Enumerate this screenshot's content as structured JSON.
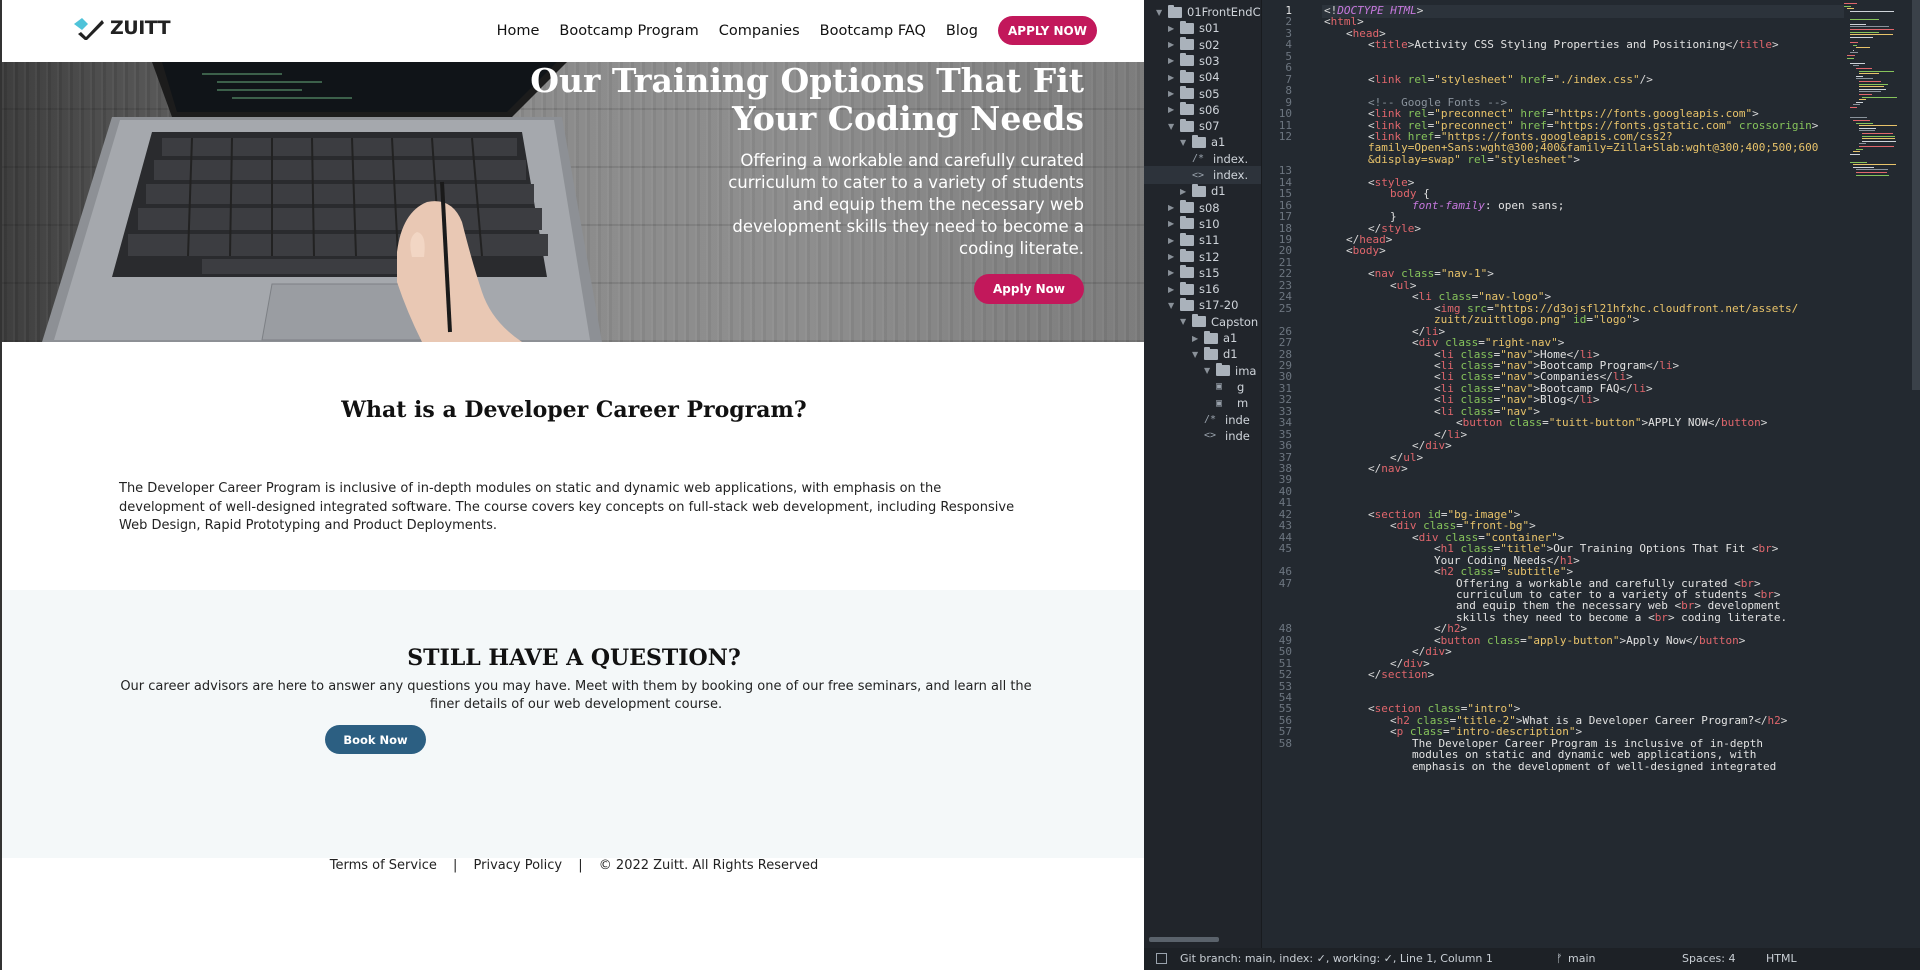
{
  "site": {
    "logo_text": "ZUITT",
    "nav": [
      "Home",
      "Bootcamp Program",
      "Companies",
      "Bootcamp FAQ",
      "Blog"
    ],
    "apply_now": "APPLY NOW",
    "hero": {
      "title_line1": "Our Training Options That Fit",
      "title_line2": "Your Coding Needs",
      "subtitle_lines": [
        "Offering a workable and carefully curated",
        "curriculum to cater to a variety of students",
        "and equip them the necessary web",
        "development skills they need to become a",
        "coding literate."
      ],
      "button": "Apply Now"
    },
    "intro": {
      "title": "What is a Developer Career Program?",
      "description": "The Developer Career Program is inclusive of in-depth modules on static and dynamic web applications, with emphasis on the development of well-designed integrated software. The course covers key concepts on full-stack web development, including Responsive Web Design, Rapid Prototyping and Product Deployments."
    },
    "question": {
      "title": "STILL HAVE A QUESTION?",
      "description": "Our career advisors are here to answer any questions you may have. Meet with them by booking one of our free seminars, and learn all the finer details of our web development course.",
      "button": "Book Now"
    },
    "footer": {
      "terms": "Terms of Service",
      "sep": "|",
      "privacy": "Privacy Policy",
      "copyright": "© 2022 Zuitt. All Rights Reserved"
    }
  },
  "editor": {
    "tree": [
      {
        "label": "01FrontEndC",
        "depth": 0,
        "open": true
      },
      {
        "label": "s01",
        "depth": 1,
        "open": false
      },
      {
        "label": "s02",
        "depth": 1,
        "open": false
      },
      {
        "label": "s03",
        "depth": 1,
        "open": false
      },
      {
        "label": "s04",
        "depth": 1,
        "open": false
      },
      {
        "label": "s05",
        "depth": 1,
        "open": false
      },
      {
        "label": "s06",
        "depth": 1,
        "open": false
      },
      {
        "label": "s07",
        "depth": 1,
        "open": true
      },
      {
        "label": "a1",
        "depth": 2,
        "open": true
      },
      {
        "label": "index.",
        "depth": 3,
        "file": "/*"
      },
      {
        "label": "index.",
        "depth": 3,
        "file": "<>",
        "active": true
      },
      {
        "label": "d1",
        "depth": 2,
        "open": false
      },
      {
        "label": "s08",
        "depth": 1,
        "open": false
      },
      {
        "label": "s10",
        "depth": 1,
        "open": false
      },
      {
        "label": "s11",
        "depth": 1,
        "open": false
      },
      {
        "label": "s12",
        "depth": 1,
        "open": false
      },
      {
        "label": "s15",
        "depth": 1,
        "open": false
      },
      {
        "label": "s16",
        "depth": 1,
        "open": false
      },
      {
        "label": "s17-20",
        "depth": 1,
        "open": true
      },
      {
        "label": "Capston",
        "depth": 2,
        "open": true
      },
      {
        "label": "a1",
        "depth": 3,
        "open": false
      },
      {
        "label": "d1",
        "depth": 3,
        "open": true
      },
      {
        "label": "ima",
        "depth": 4,
        "open": true
      },
      {
        "label": "g",
        "depth": 5,
        "file": "img"
      },
      {
        "label": "m",
        "depth": 5,
        "file": "img"
      },
      {
        "label": "inde",
        "depth": 4,
        "file": "/*"
      },
      {
        "label": "inde",
        "depth": 4,
        "file": "<>"
      }
    ],
    "status": {
      "left": "Git branch: main, index: ✓, working: ✓, Line 1, Column 1",
      "branch": "main",
      "spaces": "Spaces: 4",
      "syntax": "HTML"
    },
    "lines": [
      {
        "n": "1",
        "i": 0,
        "h": "<span class='p'>&lt;!</span><span class='k'>DOCTYPE HTML</span><span class='p'>&gt;</span>"
      },
      {
        "n": "2",
        "i": 0,
        "h": "<span class='p'>&lt;</span><span class='t'>html</span><span class='p'>&gt;</span>"
      },
      {
        "n": "3",
        "i": 1,
        "h": "<span class='p'>&lt;</span><span class='t'>head</span><span class='p'>&gt;</span>"
      },
      {
        "n": "4",
        "i": 2,
        "h": "<span class='p'>&lt;</span><span class='t'>title</span><span class='p'>&gt;</span>Activity CSS Styling Properties and Positioning<span class='p'>&lt;/</span><span class='t'>title</span><span class='p'>&gt;</span>"
      },
      {
        "n": "5",
        "i": 0,
        "h": ""
      },
      {
        "n": "6",
        "i": 0,
        "h": ""
      },
      {
        "n": "7",
        "i": 2,
        "h": "<span class='p'>&lt;</span><span class='t'>link</span> <span class='a'>rel</span>=<span class='s'>\"stylesheet\"</span> <span class='a'>href</span>=<span class='s'>\"./index.css\"</span><span class='p'>/&gt;</span>"
      },
      {
        "n": "8",
        "i": 0,
        "h": ""
      },
      {
        "n": "9",
        "i": 2,
        "h": "<span class='c'>&lt;!-- Google Fonts --&gt;</span>"
      },
      {
        "n": "10",
        "i": 2,
        "h": "<span class='p'>&lt;</span><span class='t'>link</span> <span class='a'>rel</span>=<span class='s'>\"preconnect\"</span> <span class='a'>href</span>=<span class='s'>\"https://fonts.googleapis.com\"</span><span class='p'>&gt;</span>"
      },
      {
        "n": "11",
        "i": 2,
        "h": "<span class='p'>&lt;</span><span class='t'>link</span> <span class='a'>rel</span>=<span class='s'>\"preconnect\"</span> <span class='a'>href</span>=<span class='s'>\"https://fonts.gstatic.com\"</span> <span class='a'>crossorigin</span><span class='p'>&gt;</span>"
      },
      {
        "n": "12",
        "i": 2,
        "h": "<span class='p'>&lt;</span><span class='t'>link</span> <span class='a'>href</span>=<span class='s'>\"https://fonts.googleapis.com/css2?</span>"
      },
      {
        "n": "",
        "i": 2,
        "h": "<span class='s'>family=Open+Sans:wght@300;400&amp;family=Zilla+Slab:wght@300;400;500;600</span>"
      },
      {
        "n": "",
        "i": 2,
        "h": "<span class='s'>&amp;display=swap\"</span> <span class='a'>rel</span>=<span class='s'>\"stylesheet\"</span><span class='p'>&gt;</span>"
      },
      {
        "n": "13",
        "i": 0,
        "h": ""
      },
      {
        "n": "14",
        "i": 2,
        "h": "<span class='p'>&lt;</span><span class='t'>style</span><span class='p'>&gt;</span>"
      },
      {
        "n": "15",
        "i": 3,
        "h": "<span class='t'>body</span> {"
      },
      {
        "n": "16",
        "i": 4,
        "h": "<span class='k'>font-family</span>: open sans;"
      },
      {
        "n": "17",
        "i": 3,
        "h": "}"
      },
      {
        "n": "18",
        "i": 2,
        "h": "<span class='p'>&lt;/</span><span class='t'>style</span><span class='p'>&gt;</span>"
      },
      {
        "n": "19",
        "i": 1,
        "h": "<span class='p'>&lt;/</span><span class='t'>head</span><span class='p'>&gt;</span>"
      },
      {
        "n": "20",
        "i": 1,
        "h": "<span class='p'>&lt;</span><span class='t'>body</span><span class='p'>&gt;</span>"
      },
      {
        "n": "21",
        "i": 0,
        "h": ""
      },
      {
        "n": "22",
        "i": 2,
        "h": "<span class='p'>&lt;</span><span class='t'>nav</span> <span class='a'>class</span>=<span class='s'>\"nav-1\"</span><span class='p'>&gt;</span>"
      },
      {
        "n": "23",
        "i": 3,
        "h": "<span class='p'>&lt;</span><span class='t'>ul</span><span class='p'>&gt;</span>"
      },
      {
        "n": "24",
        "i": 4,
        "h": "<span class='p'>&lt;</span><span class='t'>li</span> <span class='a'>class</span>=<span class='s'>\"nav-logo\"</span><span class='p'>&gt;</span>"
      },
      {
        "n": "25",
        "i": 5,
        "h": "<span class='p'>&lt;</span><span class='t'>img</span> <span class='a'>src</span>=<span class='s'>\"https://d3ojsfl21hfxhc.cloudfront.net/assets/</span>"
      },
      {
        "n": "",
        "i": 5,
        "h": "<span class='s'>zuitt/zuittlogo.png\"</span> <span class='a'>id</span>=<span class='s'>\"logo\"</span><span class='p'>&gt;</span>"
      },
      {
        "n": "26",
        "i": 4,
        "h": "<span class='p'>&lt;/</span><span class='t'>li</span><span class='p'>&gt;</span>"
      },
      {
        "n": "27",
        "i": 4,
        "h": "<span class='p'>&lt;</span><span class='t'>div</span> <span class='a'>class</span>=<span class='s'>\"right-nav\"</span><span class='p'>&gt;</span>"
      },
      {
        "n": "28",
        "i": 5,
        "h": "<span class='p'>&lt;</span><span class='t'>li</span> <span class='a'>class</span>=<span class='s'>\"nav\"</span><span class='p'>&gt;</span>Home<span class='p'>&lt;/</span><span class='t'>li</span><span class='p'>&gt;</span>"
      },
      {
        "n": "29",
        "i": 5,
        "h": "<span class='p'>&lt;</span><span class='t'>li</span> <span class='a'>class</span>=<span class='s'>\"nav\"</span><span class='p'>&gt;</span>Bootcamp Program<span class='p'>&lt;/</span><span class='t'>li</span><span class='p'>&gt;</span>"
      },
      {
        "n": "30",
        "i": 5,
        "h": "<span class='p'>&lt;</span><span class='t'>li</span> <span class='a'>class</span>=<span class='s'>\"nav\"</span><span class='p'>&gt;</span>Companies<span class='p'>&lt;/</span><span class='t'>li</span><span class='p'>&gt;</span>"
      },
      {
        "n": "31",
        "i": 5,
        "h": "<span class='p'>&lt;</span><span class='t'>li</span> <span class='a'>class</span>=<span class='s'>\"nav\"</span><span class='p'>&gt;</span>Bootcamp FAQ<span class='p'>&lt;/</span><span class='t'>li</span><span class='p'>&gt;</span>"
      },
      {
        "n": "32",
        "i": 5,
        "h": "<span class='p'>&lt;</span><span class='t'>li</span> <span class='a'>class</span>=<span class='s'>\"nav\"</span><span class='p'>&gt;</span>Blog<span class='p'>&lt;/</span><span class='t'>li</span><span class='p'>&gt;</span>"
      },
      {
        "n": "33",
        "i": 5,
        "h": "<span class='p'>&lt;</span><span class='t'>li</span> <span class='a'>class</span>=<span class='s'>\"nav\"</span><span class='p'>&gt;</span>"
      },
      {
        "n": "34",
        "i": 6,
        "h": "<span class='p'>&lt;</span><span class='t'>button</span> <span class='a'>class</span>=<span class='s'>\"tuitt-button\"</span><span class='p'>&gt;</span>APPLY NOW<span class='p'>&lt;/</span><span class='t'>button</span><span class='p'>&gt;</span>"
      },
      {
        "n": "35",
        "i": 5,
        "h": "<span class='p'>&lt;/</span><span class='t'>li</span><span class='p'>&gt;</span>"
      },
      {
        "n": "36",
        "i": 4,
        "h": "<span class='p'>&lt;/</span><span class='t'>div</span><span class='p'>&gt;</span>"
      },
      {
        "n": "37",
        "i": 3,
        "h": "<span class='p'>&lt;/</span><span class='t'>ul</span><span class='p'>&gt;</span>"
      },
      {
        "n": "38",
        "i": 2,
        "h": "<span class='p'>&lt;/</span><span class='t'>nav</span><span class='p'>&gt;</span>"
      },
      {
        "n": "39",
        "i": 0,
        "h": ""
      },
      {
        "n": "40",
        "i": 0,
        "h": ""
      },
      {
        "n": "41",
        "i": 0,
        "h": ""
      },
      {
        "n": "42",
        "i": 2,
        "h": "<span class='p'>&lt;</span><span class='t'>section</span> <span class='a'>id</span>=<span class='s'>\"bg-image\"</span><span class='p'>&gt;</span>"
      },
      {
        "n": "43",
        "i": 3,
        "h": "<span class='p'>&lt;</span><span class='t'>div</span> <span class='a'>class</span>=<span class='s'>\"front-bg\"</span><span class='p'>&gt;</span>"
      },
      {
        "n": "44",
        "i": 4,
        "h": "<span class='p'>&lt;</span><span class='t'>div</span> <span class='a'>class</span>=<span class='s'>\"container\"</span><span class='p'>&gt;</span>"
      },
      {
        "n": "45",
        "i": 5,
        "h": "<span class='p'>&lt;</span><span class='t'>h1</span> <span class='a'>class</span>=<span class='s'>\"title\"</span><span class='p'>&gt;</span>Our Training Options That Fit <span class='p'>&lt;</span><span class='t'>br</span><span class='p'>&gt;</span>"
      },
      {
        "n": "",
        "i": 5,
        "h": "Your Coding Needs<span class='p'>&lt;/</span><span class='t'>h1</span><span class='p'>&gt;</span>"
      },
      {
        "n": "46",
        "i": 5,
        "h": "<span class='p'>&lt;</span><span class='t'>h2</span> <span class='a'>class</span>=<span class='s'>\"subtitle\"</span><span class='p'>&gt;</span>"
      },
      {
        "n": "47",
        "i": 6,
        "h": "Offering a workable and carefully curated <span class='p'>&lt;</span><span class='t'>br</span><span class='p'>&gt;</span>"
      },
      {
        "n": "",
        "i": 6,
        "h": "curriculum to cater to a variety of students <span class='p'>&lt;</span><span class='t'>br</span><span class='p'>&gt;</span>"
      },
      {
        "n": "",
        "i": 6,
        "h": "and equip them the necessary web <span class='p'>&lt;</span><span class='t'>br</span><span class='p'>&gt;</span> development"
      },
      {
        "n": "",
        "i": 6,
        "h": "skills they need to become a <span class='p'>&lt;</span><span class='t'>br</span><span class='p'>&gt;</span> coding literate."
      },
      {
        "n": "48",
        "i": 5,
        "h": "<span class='p'>&lt;/</span><span class='t'>h2</span><span class='p'>&gt;</span>"
      },
      {
        "n": "49",
        "i": 5,
        "h": "<span class='p'>&lt;</span><span class='t'>button</span> <span class='a'>class</span>=<span class='s'>\"apply-button\"</span><span class='p'>&gt;</span>Apply Now<span class='p'>&lt;/</span><span class='t'>button</span><span class='p'>&gt;</span>"
      },
      {
        "n": "50",
        "i": 4,
        "h": "<span class='p'>&lt;/</span><span class='t'>div</span><span class='p'>&gt;</span>"
      },
      {
        "n": "51",
        "i": 3,
        "h": "<span class='p'>&lt;/</span><span class='t'>div</span><span class='p'>&gt;</span>"
      },
      {
        "n": "52",
        "i": 2,
        "h": "<span class='p'>&lt;/</span><span class='t'>section</span><span class='p'>&gt;</span>"
      },
      {
        "n": "53",
        "i": 0,
        "h": ""
      },
      {
        "n": "54",
        "i": 0,
        "h": ""
      },
      {
        "n": "55",
        "i": 2,
        "h": "<span class='p'>&lt;</span><span class='t'>section</span> <span class='a'>class</span>=<span class='s'>\"intro\"</span><span class='p'>&gt;</span>"
      },
      {
        "n": "56",
        "i": 3,
        "h": "<span class='p'>&lt;</span><span class='t'>h2</span> <span class='a'>class</span>=<span class='s'>\"title-2\"</span><span class='p'>&gt;</span>What is a Developer Career Program?<span class='p'>&lt;/</span><span class='t'>h2</span><span class='p'>&gt;</span>"
      },
      {
        "n": "57",
        "i": 3,
        "h": "<span class='p'>&lt;</span><span class='t'>p</span> <span class='a'>class</span>=<span class='s'>\"intro-description\"</span><span class='p'>&gt;</span>"
      },
      {
        "n": "58",
        "i": 4,
        "h": "The Developer Career Program is inclusive of in-depth"
      },
      {
        "n": "",
        "i": 4,
        "h": "modules on static and dynamic web applications, with"
      },
      {
        "n": "",
        "i": 4,
        "h": "emphasis on the development of well-designed integrated"
      }
    ]
  }
}
